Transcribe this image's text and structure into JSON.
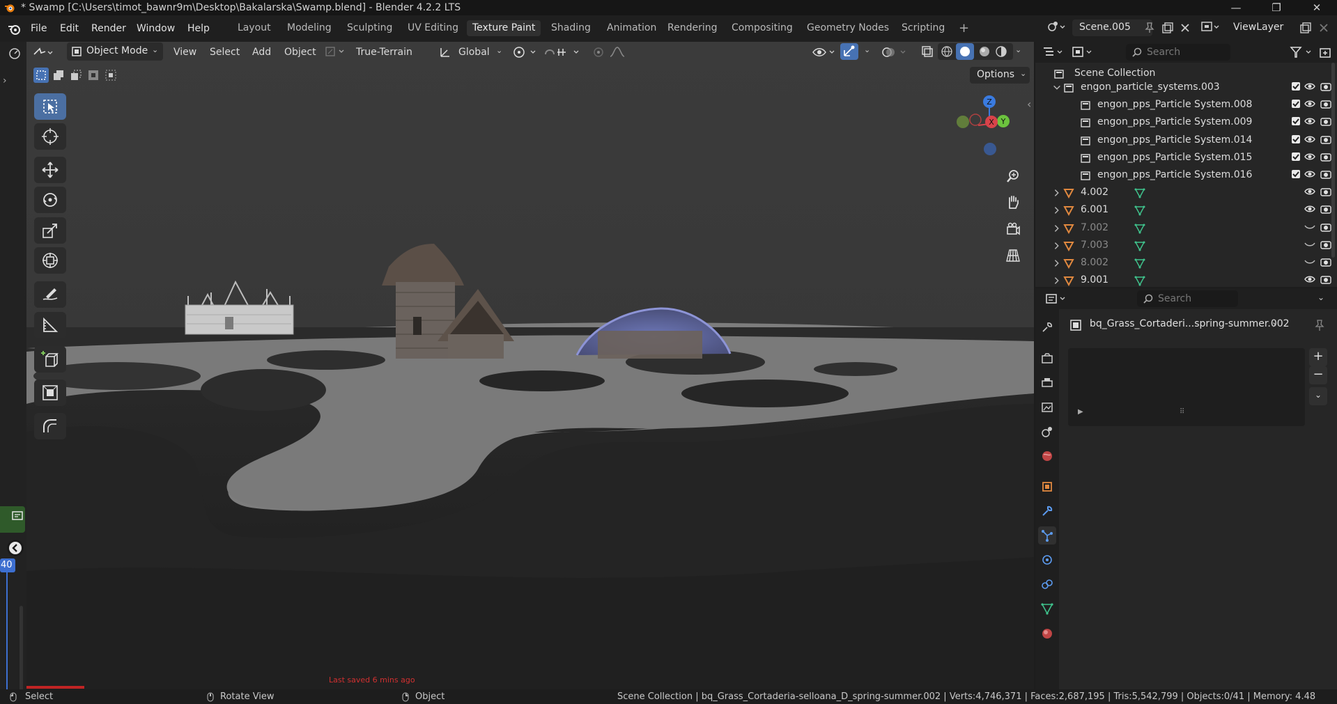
{
  "window": {
    "title": "* Swamp [C:\\Users\\timot_bawnr9m\\Desktop\\Bakalarska\\Swamp.blend] - Blender 4.2.2 LTS",
    "controls": [
      "—",
      "❐",
      "✕"
    ]
  },
  "menu": [
    "File",
    "Edit",
    "Render",
    "Window",
    "Help"
  ],
  "workspaces": [
    {
      "label": "Layout",
      "active": false
    },
    {
      "label": "Modeling",
      "active": false
    },
    {
      "label": "Sculpting",
      "active": false
    },
    {
      "label": "UV Editing",
      "active": false
    },
    {
      "label": "Texture Paint",
      "active": true
    },
    {
      "label": "Shading",
      "active": false
    },
    {
      "label": "Animation",
      "active": false
    },
    {
      "label": "Rendering",
      "active": false
    },
    {
      "label": "Compositing",
      "active": false
    },
    {
      "label": "Geometry Nodes",
      "active": false
    },
    {
      "label": "Scripting",
      "active": false
    }
  ],
  "scene": {
    "name": "Scene.005",
    "view_layer": "ViewLayer"
  },
  "viewport_header": {
    "mode": "Object Mode",
    "menus": [
      "View",
      "Select",
      "Add",
      "Object"
    ],
    "active_object": "True-Terrain",
    "orientation": "Global",
    "options": "Options"
  },
  "viewport": {
    "last_saved": "Last saved 6 mins ago",
    "frame": "40",
    "gizmo": {
      "z": "Z",
      "x": "X",
      "y": "Y"
    }
  },
  "outliner": {
    "search_placeholder": "Search",
    "root": "Scene Collection",
    "rows": [
      {
        "label": "engon_particle_systems.003",
        "level": 1,
        "type": "collection",
        "expanded": true,
        "dim": false,
        "checkbox": true,
        "visible": true
      },
      {
        "label": "engon_pps_Particle System.008",
        "level": 2,
        "type": "collection",
        "dim": false,
        "checkbox": true,
        "visible": true
      },
      {
        "label": "engon_pps_Particle System.009",
        "level": 2,
        "type": "collection",
        "dim": false,
        "checkbox": true,
        "visible": true
      },
      {
        "label": "engon_pps_Particle System.014",
        "level": 2,
        "type": "collection",
        "dim": false,
        "checkbox": true,
        "visible": true
      },
      {
        "label": "engon_pps_Particle System.015",
        "level": 2,
        "type": "collection",
        "dim": false,
        "checkbox": true,
        "visible": true
      },
      {
        "label": "engon_pps_Particle System.016",
        "level": 2,
        "type": "collection",
        "dim": false,
        "checkbox": true,
        "visible": true
      },
      {
        "label": "4.002",
        "level": 1,
        "type": "mesh",
        "dim": false,
        "checkbox": false,
        "visible": true
      },
      {
        "label": "6.001",
        "level": 1,
        "type": "mesh",
        "dim": false,
        "checkbox": false,
        "visible": true
      },
      {
        "label": "7.002",
        "level": 1,
        "type": "mesh",
        "dim": true,
        "checkbox": false,
        "visible": false
      },
      {
        "label": "7.003",
        "level": 1,
        "type": "mesh",
        "dim": true,
        "checkbox": false,
        "visible": false
      },
      {
        "label": "8.002",
        "level": 1,
        "type": "mesh",
        "dim": true,
        "checkbox": false,
        "visible": false
      },
      {
        "label": "9.001",
        "level": 1,
        "type": "mesh",
        "dim": false,
        "checkbox": false,
        "visible": true
      }
    ]
  },
  "properties": {
    "search_placeholder": "Search",
    "material_name": "bq_Grass_Cortaderi...spring-summer.002"
  },
  "statusbar": {
    "select": "Select",
    "rotate": "Rotate View",
    "object": "Object",
    "info": "Scene Collection | bq_Grass_Cortaderia-selloana_D_spring-summer.002 | Verts:4,746,371 | Faces:2,687,195 | Tris:5,542,799 | Objects:0/41 | Memory: 4.48"
  },
  "colors": {
    "accent": "#4772b3",
    "active_tab": "#303030",
    "mesh_icon": "#e0883f",
    "data_icon": "#3fc28c",
    "saved_text": "#d13030",
    "timeline_marker": "#3d6fd0"
  }
}
